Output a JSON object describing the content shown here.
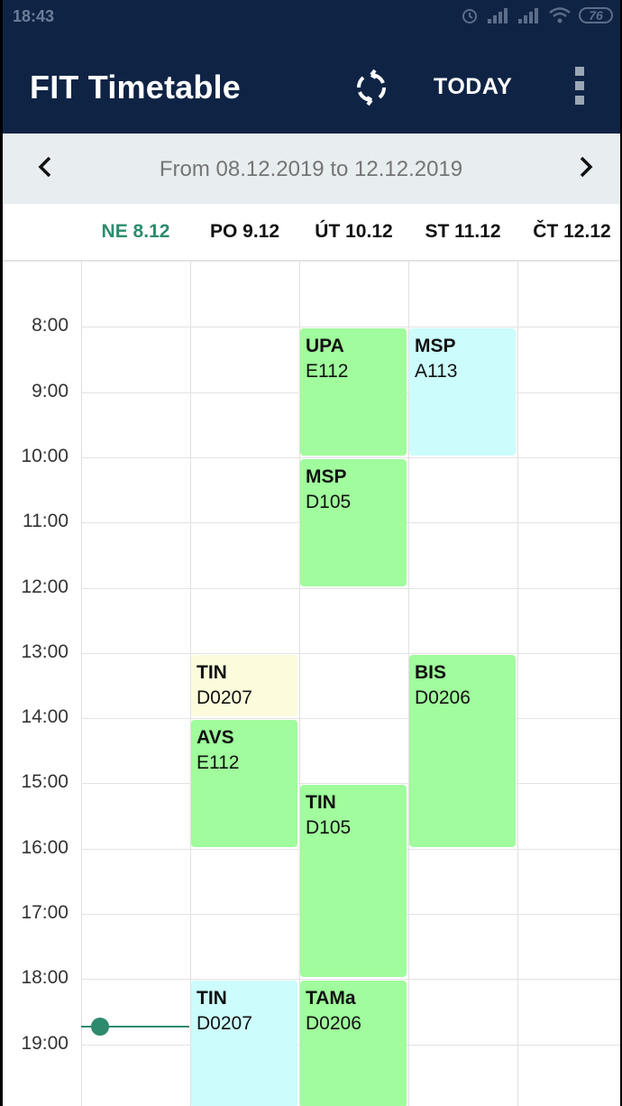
{
  "status": {
    "time": "18:43",
    "battery": "76"
  },
  "appbar": {
    "title": "FIT Timetable",
    "today_label": "TODAY"
  },
  "range": {
    "text": "From 08.12.2019 to 12.12.2019"
  },
  "days": [
    {
      "label": "NE 8.12",
      "is_today": true
    },
    {
      "label": "PO 9.12",
      "is_today": false
    },
    {
      "label": "ÚT 10.12",
      "is_today": false
    },
    {
      "label": "ST 11.12",
      "is_today": false
    },
    {
      "label": "ČT 12.12",
      "is_today": false
    }
  ],
  "hours": [
    "8:00",
    "9:00",
    "10:00",
    "11:00",
    "12:00",
    "13:00",
    "14:00",
    "15:00",
    "16:00",
    "17:00",
    "18:00",
    "19:00"
  ],
  "events": [
    {
      "code": "UPA",
      "room": "E112",
      "day": 2,
      "start": 8,
      "end": 10,
      "color": "#a0fc9c"
    },
    {
      "code": "MSP",
      "room": "A113",
      "day": 3,
      "start": 8,
      "end": 10,
      "color": "#ccfcfc"
    },
    {
      "code": "MSP",
      "room": "D105",
      "day": 2,
      "start": 10,
      "end": 12,
      "color": "#a0fc9c"
    },
    {
      "code": "TIN",
      "room": "D0207",
      "day": 1,
      "start": 13,
      "end": 14,
      "color": "#fcfcdc"
    },
    {
      "code": "BIS",
      "room": "D0206",
      "day": 3,
      "start": 13,
      "end": 16,
      "color": "#a0fc9c"
    },
    {
      "code": "AVS",
      "room": "E112",
      "day": 1,
      "start": 14,
      "end": 16,
      "color": "#a0fc9c"
    },
    {
      "code": "TIN",
      "room": "D105",
      "day": 2,
      "start": 15,
      "end": 18,
      "color": "#a0fc9c"
    },
    {
      "code": "TIN",
      "room": "D0207",
      "day": 1,
      "start": 18,
      "end": 20,
      "color": "#ccfcfc"
    },
    {
      "code": "TAMa",
      "room": "D0206",
      "day": 2,
      "start": 18,
      "end": 20,
      "color": "#a0fc9c"
    }
  ],
  "current_time_hour": 18.72,
  "colors": {
    "primary": "#0f2445",
    "accent": "#2e8a6c"
  }
}
